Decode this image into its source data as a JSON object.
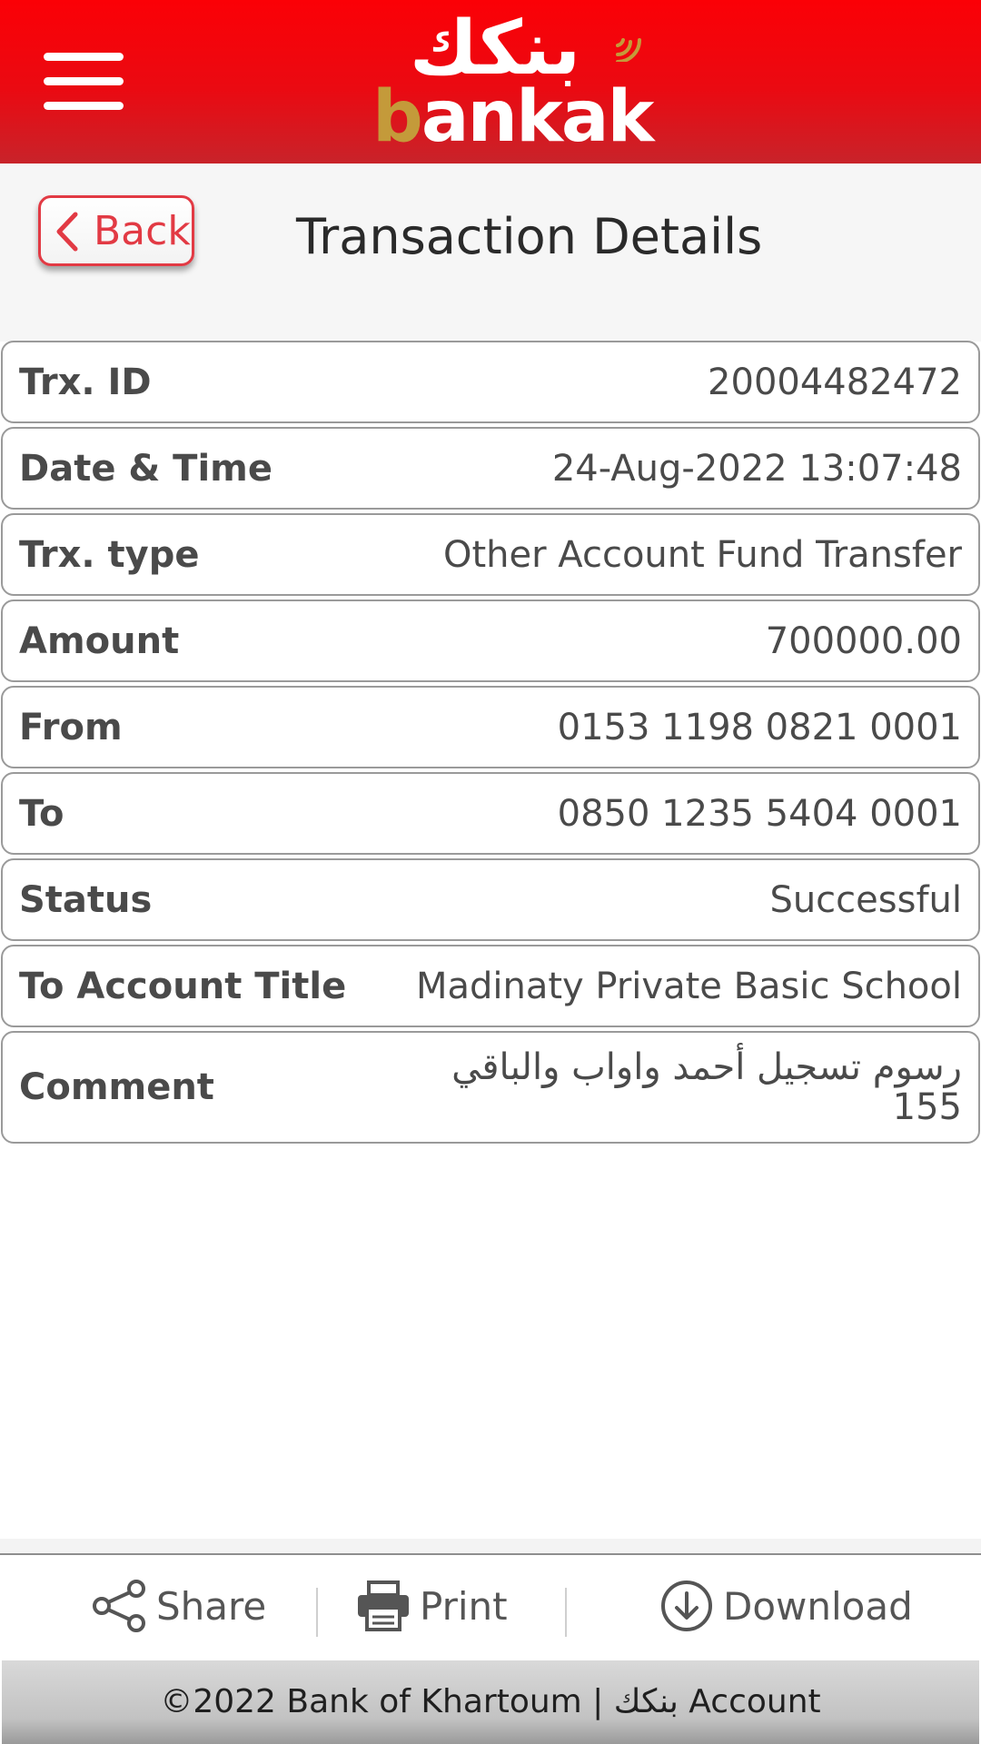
{
  "header": {
    "logo_arabic": "بنكك",
    "logo_b": "b",
    "logo_rest": "ankak",
    "icons": {
      "menu": "hamburger-menu-icon",
      "wifi": "signal-waves-icon"
    },
    "colors": {
      "primary": "#e60a10",
      "gold": "#c49a3a"
    }
  },
  "titlebar": {
    "back_label": "Back",
    "title": "Transaction Details"
  },
  "details": [
    {
      "label": "Trx. ID",
      "value": "20004482472"
    },
    {
      "label": "Date & Time",
      "value": "24-Aug-2022 13:07:48"
    },
    {
      "label": "Trx. type",
      "value": "Other Account Fund Transfer"
    },
    {
      "label": "Amount",
      "value": "700000.00"
    },
    {
      "label": "From",
      "value": "0153 1198 0821 0001"
    },
    {
      "label": "To",
      "value": "0850 1235 5404 0001"
    },
    {
      "label": "Status",
      "value": "Successful"
    },
    {
      "label": "To Account Title",
      "value": "Madinaty Private Basic School"
    },
    {
      "label": "Comment",
      "value_line1": "رسوم تسجيل أحمد واواب والباقي",
      "value_line2": "155"
    }
  ],
  "actions": {
    "share": {
      "label": "Share",
      "icon": "share-icon"
    },
    "print": {
      "label": "Print",
      "icon": "printer-icon"
    },
    "download": {
      "label": "Download",
      "icon": "download-circle-icon"
    }
  },
  "footer": {
    "text": "©2022 Bank of Khartoum | بنكك Account"
  }
}
